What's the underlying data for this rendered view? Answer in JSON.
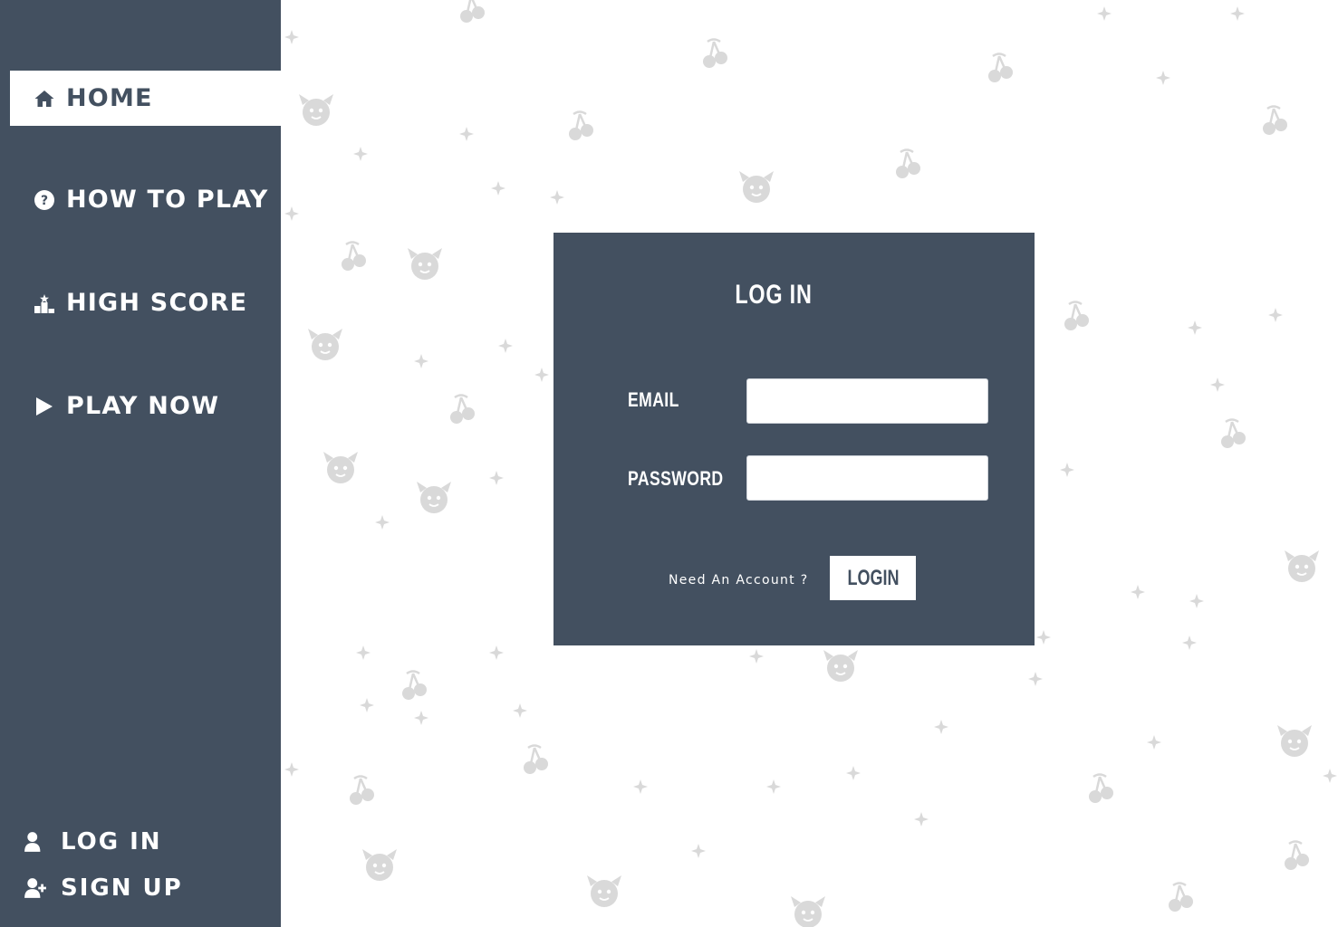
{
  "sidebar": {
    "nav": [
      {
        "label": "HOME",
        "icon": "home-icon",
        "active": true
      },
      {
        "label": "HOW TO PLAY",
        "icon": "question-circle-icon",
        "active": false
      },
      {
        "label": "HIGH SCORE",
        "icon": "podium-icon",
        "active": false
      },
      {
        "label": "PLAY NOW",
        "icon": "play-icon",
        "active": false
      }
    ],
    "auth": [
      {
        "label": "LOG IN",
        "icon": "user-icon"
      },
      {
        "label": "SIGN UP",
        "icon": "user-plus-icon"
      }
    ]
  },
  "login_panel": {
    "title": "LOG IN",
    "email_label": "EMAIL",
    "email_value": "",
    "password_label": "PASSWORD",
    "password_value": "",
    "need_account": "Need An Account ?",
    "login_button": "LOGIN"
  },
  "background": {
    "pattern_icons": [
      "cherry-icon",
      "devil-face-icon",
      "sparkle-icon"
    ]
  },
  "colors": {
    "sidebar": "#435060",
    "panel": "#435060",
    "page_background": "#ffffff",
    "pattern": "#d9d9d9",
    "text_light": "#ffffff"
  }
}
